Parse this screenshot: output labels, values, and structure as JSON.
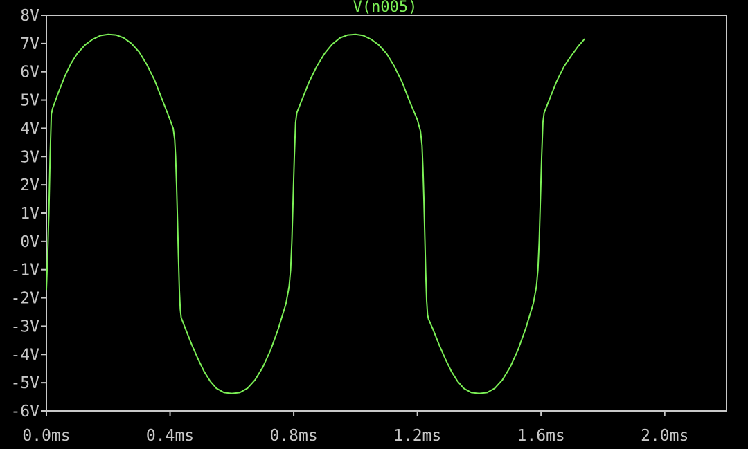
{
  "colors": {
    "background": "#000000",
    "frame": "#c8c8c8",
    "tick_label": "#c8c8c8",
    "trace": "#7cf056",
    "title": "#7cf056"
  },
  "chart_data": {
    "type": "line",
    "title": "V(n005)",
    "xlabel": "",
    "ylabel": "",
    "x_unit": "ms",
    "y_unit": "V",
    "xlim": [
      0.0,
      2.2
    ],
    "ylim": [
      -6,
      8
    ],
    "grid": false,
    "x_ticks": [
      {
        "value": 0.0,
        "label": "0.0ms"
      },
      {
        "value": 0.4,
        "label": "0.4ms"
      },
      {
        "value": 0.8,
        "label": "0.8ms"
      },
      {
        "value": 1.2,
        "label": "1.2ms"
      },
      {
        "value": 1.6,
        "label": "1.6ms"
      },
      {
        "value": 2.0,
        "label": "2.0ms"
      }
    ],
    "y_ticks": [
      {
        "value": 8,
        "label": "8V"
      },
      {
        "value": 7,
        "label": "7V"
      },
      {
        "value": 6,
        "label": "6V"
      },
      {
        "value": 5,
        "label": "5V"
      },
      {
        "value": 4,
        "label": "4V"
      },
      {
        "value": 3,
        "label": "3V"
      },
      {
        "value": 2,
        "label": "2V"
      },
      {
        "value": 1,
        "label": "1V"
      },
      {
        "value": 0,
        "label": "0V"
      },
      {
        "value": -1,
        "label": "-1V"
      },
      {
        "value": -2,
        "label": "-2V"
      },
      {
        "value": -3,
        "label": "-3V"
      },
      {
        "value": -4,
        "label": "-4V"
      },
      {
        "value": -5,
        "label": "-5V"
      },
      {
        "value": -6,
        "label": "-6V"
      }
    ],
    "series": [
      {
        "points": [
          [
            0.0,
            -1.7
          ],
          [
            0.004,
            -0.5
          ],
          [
            0.008,
            1.0
          ],
          [
            0.012,
            3.0
          ],
          [
            0.016,
            4.5
          ],
          [
            0.02,
            4.7
          ],
          [
            0.04,
            5.3
          ],
          [
            0.06,
            5.85
          ],
          [
            0.08,
            6.3
          ],
          [
            0.1,
            6.65
          ],
          [
            0.125,
            6.95
          ],
          [
            0.15,
            7.15
          ],
          [
            0.175,
            7.28
          ],
          [
            0.2,
            7.32
          ],
          [
            0.225,
            7.3
          ],
          [
            0.25,
            7.2
          ],
          [
            0.275,
            7.0
          ],
          [
            0.3,
            6.7
          ],
          [
            0.325,
            6.25
          ],
          [
            0.35,
            5.7
          ],
          [
            0.375,
            5.0
          ],
          [
            0.4,
            4.3
          ],
          [
            0.41,
            4.0
          ],
          [
            0.415,
            3.6
          ],
          [
            0.418,
            3.0
          ],
          [
            0.421,
            2.0
          ],
          [
            0.424,
            0.8
          ],
          [
            0.427,
            -0.5
          ],
          [
            0.43,
            -1.7
          ],
          [
            0.433,
            -2.4
          ],
          [
            0.436,
            -2.7
          ],
          [
            0.45,
            -3.1
          ],
          [
            0.47,
            -3.65
          ],
          [
            0.49,
            -4.15
          ],
          [
            0.51,
            -4.6
          ],
          [
            0.53,
            -4.95
          ],
          [
            0.55,
            -5.2
          ],
          [
            0.575,
            -5.35
          ],
          [
            0.6,
            -5.38
          ],
          [
            0.625,
            -5.35
          ],
          [
            0.65,
            -5.2
          ],
          [
            0.675,
            -4.9
          ],
          [
            0.7,
            -4.45
          ],
          [
            0.725,
            -3.85
          ],
          [
            0.75,
            -3.1
          ],
          [
            0.775,
            -2.2
          ],
          [
            0.785,
            -1.6
          ],
          [
            0.79,
            -1.0
          ],
          [
            0.794,
            0.0
          ],
          [
            0.798,
            1.5
          ],
          [
            0.802,
            3.0
          ],
          [
            0.806,
            4.2
          ],
          [
            0.81,
            4.55
          ],
          [
            0.83,
            5.1
          ],
          [
            0.85,
            5.65
          ],
          [
            0.875,
            6.2
          ],
          [
            0.9,
            6.65
          ],
          [
            0.925,
            6.98
          ],
          [
            0.95,
            7.2
          ],
          [
            0.975,
            7.3
          ],
          [
            1.0,
            7.32
          ],
          [
            1.025,
            7.28
          ],
          [
            1.05,
            7.15
          ],
          [
            1.075,
            6.95
          ],
          [
            1.1,
            6.65
          ],
          [
            1.125,
            6.2
          ],
          [
            1.15,
            5.65
          ],
          [
            1.175,
            4.95
          ],
          [
            1.2,
            4.3
          ],
          [
            1.21,
            3.9
          ],
          [
            1.215,
            3.4
          ],
          [
            1.218,
            2.6
          ],
          [
            1.221,
            1.5
          ],
          [
            1.224,
            0.2
          ],
          [
            1.227,
            -1.1
          ],
          [
            1.23,
            -2.1
          ],
          [
            1.233,
            -2.6
          ],
          [
            1.236,
            -2.75
          ],
          [
            1.25,
            -3.1
          ],
          [
            1.27,
            -3.65
          ],
          [
            1.29,
            -4.15
          ],
          [
            1.31,
            -4.6
          ],
          [
            1.33,
            -4.95
          ],
          [
            1.35,
            -5.2
          ],
          [
            1.375,
            -5.35
          ],
          [
            1.4,
            -5.38
          ],
          [
            1.425,
            -5.35
          ],
          [
            1.45,
            -5.2
          ],
          [
            1.475,
            -4.9
          ],
          [
            1.5,
            -4.45
          ],
          [
            1.525,
            -3.85
          ],
          [
            1.55,
            -3.1
          ],
          [
            1.575,
            -2.2
          ],
          [
            1.585,
            -1.6
          ],
          [
            1.59,
            -1.0
          ],
          [
            1.594,
            0.0
          ],
          [
            1.598,
            1.5
          ],
          [
            1.602,
            3.0
          ],
          [
            1.606,
            4.2
          ],
          [
            1.61,
            4.55
          ],
          [
            1.63,
            5.1
          ],
          [
            1.65,
            5.65
          ],
          [
            1.675,
            6.2
          ],
          [
            1.7,
            6.6
          ],
          [
            1.72,
            6.9
          ],
          [
            1.74,
            7.15
          ]
        ]
      }
    ]
  }
}
